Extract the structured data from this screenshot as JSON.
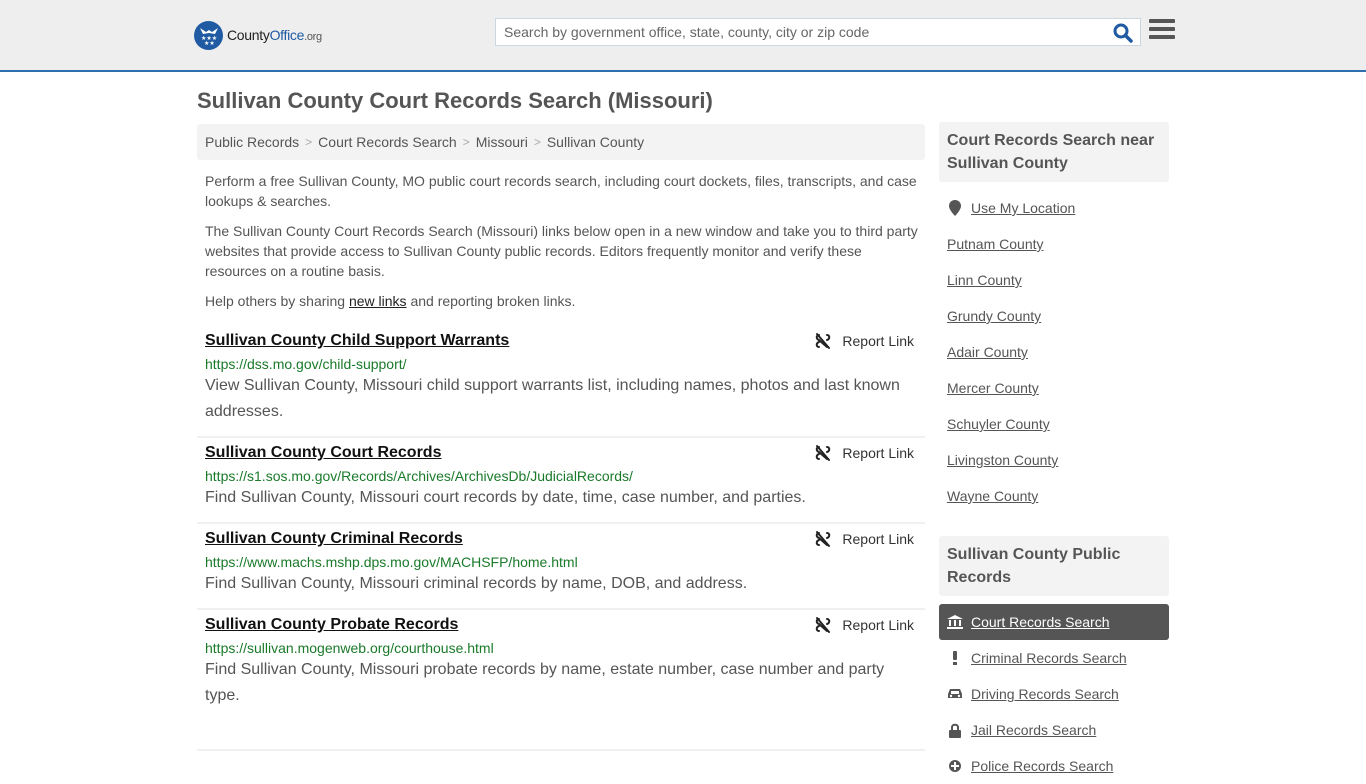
{
  "header": {
    "logo": {
      "county": "County",
      "office": "Office",
      "org": ".org"
    },
    "search": {
      "placeholder": "Search by government office, state, county, city or zip code",
      "value": ""
    },
    "colors": {
      "brand": "#1f5aa3",
      "header_border": "#2e6fb0"
    }
  },
  "page": {
    "title": "Sullivan County Court Records Search (Missouri)"
  },
  "breadcrumb": [
    {
      "label": "Public Records"
    },
    {
      "label": "Court Records Search"
    },
    {
      "label": "Missouri"
    },
    {
      "label": "Sullivan County"
    }
  ],
  "intro": {
    "p1": "Perform a free Sullivan County, MO public court records search, including court dockets, files, transcripts, and case lookups & searches.",
    "p2": "The Sullivan County Court Records Search (Missouri) links below open in a new window and take you to third party websites that provide access to Sullivan County public records. Editors frequently monitor and verify these resources on a routine basis.",
    "p3_before": "Help others by sharing ",
    "p3_link": "new links",
    "p3_after": " and reporting broken links."
  },
  "results": [
    {
      "title": "Sullivan County Child Support Warrants",
      "url": "https://dss.mo.gov/child-support/",
      "description": "View Sullivan County, Missouri child support warrants list, including names, photos and last known addresses.",
      "report_label": "Report Link"
    },
    {
      "title": "Sullivan County Court Records",
      "url": "https://s1.sos.mo.gov/Records/Archives/ArchivesDb/JudicialRecords/",
      "description": "Find Sullivan County, Missouri court records by date, time, case number, and parties.",
      "report_label": "Report Link"
    },
    {
      "title": "Sullivan County Criminal Records",
      "url": "https://www.machs.mshp.dps.mo.gov/MACHSFP/home.html",
      "description": "Find Sullivan County, Missouri criminal records by name, DOB, and address.",
      "report_label": "Report Link"
    },
    {
      "title": "Sullivan County Probate Records",
      "url": "https://sullivan.mogenweb.org/courthouse.html",
      "description": "Find Sullivan County, Missouri probate records by name, estate number, case number and party type.",
      "report_label": "Report Link"
    }
  ],
  "sidebar": {
    "nearby": {
      "title": "Court Records Search near Sullivan County",
      "use_location": "Use My Location",
      "counties": [
        "Putnam County",
        "Linn County",
        "Grundy County",
        "Adair County",
        "Mercer County",
        "Schuyler County",
        "Livingston County",
        "Wayne County"
      ]
    },
    "public_records": {
      "title": "Sullivan County Public Records",
      "items": [
        {
          "label": "Court Records Search",
          "icon": "courthouse-icon",
          "active": true
        },
        {
          "label": "Criminal Records Search",
          "icon": "exclamation-icon",
          "active": false
        },
        {
          "label": "Driving Records Search",
          "icon": "car-icon",
          "active": false
        },
        {
          "label": "Jail Records Search",
          "icon": "lock-icon",
          "active": false
        },
        {
          "label": "Police Records Search",
          "icon": "police-badge-icon",
          "active": false
        }
      ]
    }
  }
}
